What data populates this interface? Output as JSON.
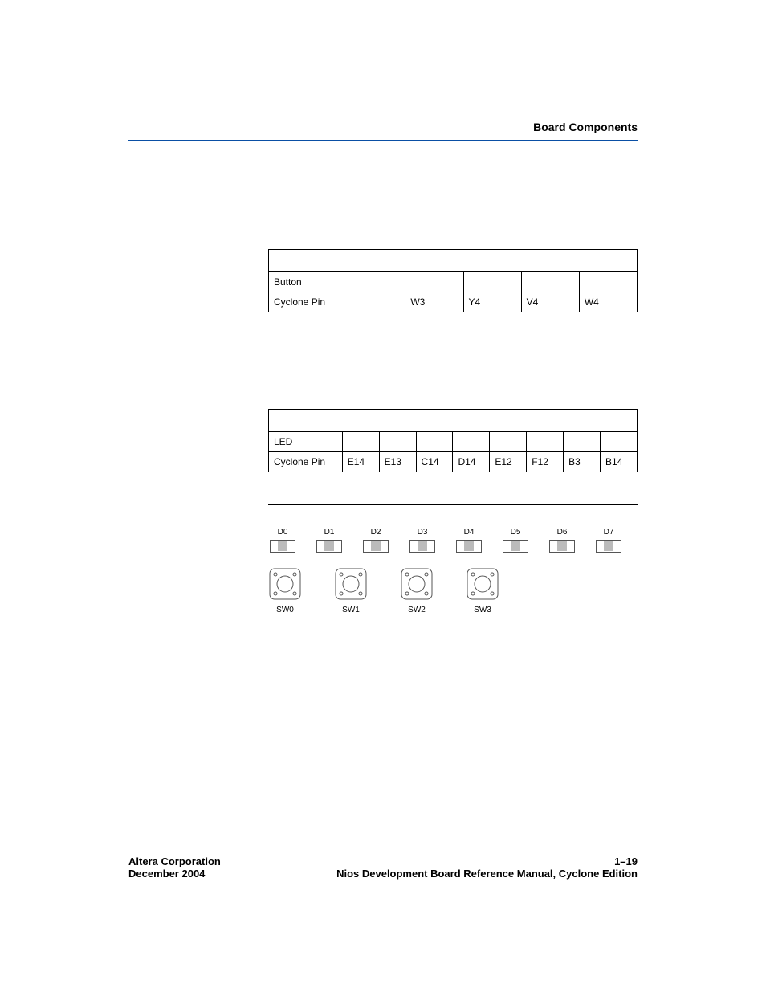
{
  "header": {
    "section": "Board Components"
  },
  "table1": {
    "rows": [
      {
        "label": "Button",
        "cells": [
          "",
          "",
          "",
          ""
        ]
      },
      {
        "label": "Cyclone Pin",
        "cells": [
          "W3",
          "Y4",
          "V4",
          "W4"
        ]
      }
    ]
  },
  "table2": {
    "rows": [
      {
        "label": "LED",
        "cells": [
          "",
          "",
          "",
          "",
          "",
          "",
          "",
          ""
        ]
      },
      {
        "label": "Cyclone Pin",
        "cells": [
          "E14",
          "E13",
          "C14",
          "D14",
          "E12",
          "F12",
          "B3",
          "B14"
        ]
      }
    ]
  },
  "figure": {
    "leds": [
      "D0",
      "D1",
      "D2",
      "D3",
      "D4",
      "D5",
      "D6",
      "D7"
    ],
    "switches": [
      "SW0",
      "SW1",
      "SW2",
      "SW3"
    ]
  },
  "footer": {
    "left_line1": "Altera Corporation",
    "left_line2": "December 2004",
    "right_line1": "1–19",
    "right_line2": "Nios Development Board Reference Manual, Cyclone Edition"
  }
}
